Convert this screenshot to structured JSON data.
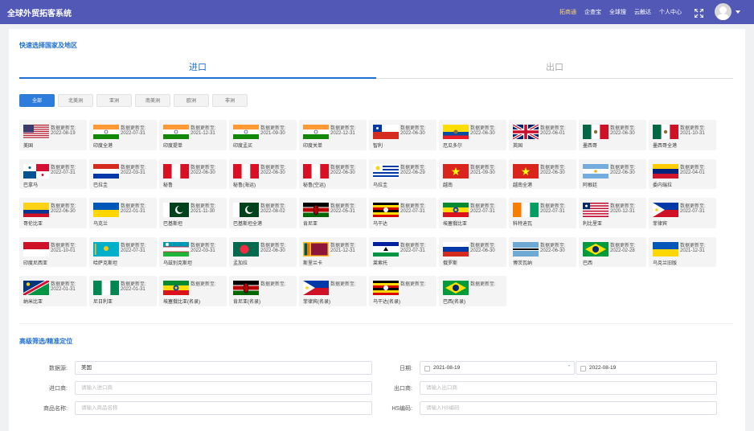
{
  "header": {
    "app_title": "全球外贸拓客系统",
    "nav": [
      {
        "label": "拓商通",
        "active": true
      },
      {
        "label": "企查宝",
        "active": false
      },
      {
        "label": "全球搜",
        "active": false
      },
      {
        "label": "云触达",
        "active": false
      },
      {
        "label": "个人中心",
        "active": false
      }
    ]
  },
  "quick_select": {
    "title": "快速选择国家及地区",
    "tabs": {
      "import": "进口",
      "export": "出口"
    },
    "regions": [
      "全部",
      "北美洲",
      "亚洲",
      "南美洲",
      "欧洲",
      "非洲"
    ],
    "update_label": "数据更新至:",
    "countries": [
      {
        "name": "美国",
        "date": "2022-08-19",
        "flag": "us"
      },
      {
        "name": "印度全港",
        "date": "2022-07-31",
        "flag": "in"
      },
      {
        "name": "印度提单",
        "date": "2021-12-31",
        "flag": "in"
      },
      {
        "name": "印度孟买",
        "date": "2021-09-30",
        "flag": "in"
      },
      {
        "name": "印度关单",
        "date": "2022-12-31",
        "flag": "in"
      },
      {
        "name": "智利",
        "date": "2022-06-30",
        "flag": "cl"
      },
      {
        "name": "厄瓜多尔",
        "date": "2022-06-30",
        "flag": "ec"
      },
      {
        "name": "英国",
        "date": "2022-06-01",
        "flag": "gb"
      },
      {
        "name": "墨西哥",
        "date": "2022-06-30",
        "flag": "mx"
      },
      {
        "name": "墨西哥全港",
        "date": "2021-10-31",
        "flag": "mx"
      },
      {
        "name": "巴拿马",
        "date": "2022-07-31",
        "flag": "pa"
      },
      {
        "name": "巴拉圭",
        "date": "2022-03-31",
        "flag": "py"
      },
      {
        "name": "秘鲁",
        "date": "2022-06-30",
        "flag": "pe"
      },
      {
        "name": "秘鲁(海运)",
        "date": "2022-06-30",
        "flag": "pe"
      },
      {
        "name": "秘鲁(空运)",
        "date": "2022-06-30",
        "flag": "pe"
      },
      {
        "name": "乌拉圭",
        "date": "2022-06-29",
        "flag": "uy"
      },
      {
        "name": "越南",
        "date": "2021-09-30",
        "flag": "vn"
      },
      {
        "name": "越南全港",
        "date": "2022-06-30",
        "flag": "vn"
      },
      {
        "name": "阿根廷",
        "date": "2022-06-30",
        "flag": "ar"
      },
      {
        "name": "委内瑞拉",
        "date": "2022-04-01",
        "flag": "ve"
      },
      {
        "name": "哥伦比亚",
        "date": "2022-06-30",
        "flag": "co"
      },
      {
        "name": "乌克兰",
        "date": "2022-01-31",
        "flag": "ua"
      },
      {
        "name": "巴基斯坦",
        "date": "2021-11-30",
        "flag": "pk"
      },
      {
        "name": "巴基斯坦全港",
        "date": "2022-08-02",
        "flag": "pk"
      },
      {
        "name": "肯尼亚",
        "date": "2022-05-31",
        "flag": "ke"
      },
      {
        "name": "乌干达",
        "date": "2022-07-31",
        "flag": "ug"
      },
      {
        "name": "埃塞俄比亚",
        "date": "2022-07-31",
        "flag": "et"
      },
      {
        "name": "科特迪瓦",
        "date": "2022-07-31",
        "flag": "ci"
      },
      {
        "name": "利比里亚",
        "date": "2020-12-31",
        "flag": "lr"
      },
      {
        "name": "菲律宾",
        "date": "2022-07-31",
        "flag": "ph"
      },
      {
        "name": "印度尼西亚",
        "date": "2021-10-01",
        "flag": "id"
      },
      {
        "name": "哈萨克斯坦",
        "date": "2022-07-31",
        "flag": "kz"
      },
      {
        "name": "乌兹别克斯坦",
        "date": "2022-03-31",
        "flag": "uz"
      },
      {
        "name": "孟加拉",
        "date": "2022-06-30",
        "flag": "bd"
      },
      {
        "name": "斯里兰卡",
        "date": "2021-12-31",
        "flag": "lk"
      },
      {
        "name": "莱索托",
        "date": "2022-07-31",
        "flag": "ls"
      },
      {
        "name": "俄罗斯",
        "date": "2022-06-30",
        "flag": "ru"
      },
      {
        "name": "博茨瓦纳",
        "date": "2022-06-30",
        "flag": "bw"
      },
      {
        "name": "巴西",
        "date": "2022-02-28",
        "flag": "br"
      },
      {
        "name": "乌克兰旧版",
        "date": "2021-12-31",
        "flag": "ua"
      },
      {
        "name": "纳米比亚",
        "date": "2022-01-31",
        "flag": "na"
      },
      {
        "name": "尼日利亚",
        "date": "2022-01-31",
        "flag": "ng"
      },
      {
        "name": "埃塞俄比亚(名录)",
        "date": "",
        "flag": "et"
      },
      {
        "name": "肯尼亚(名录)",
        "date": "",
        "flag": "ke"
      },
      {
        "name": "菲律宾(名录)",
        "date": "",
        "flag": "ph"
      },
      {
        "name": "乌干达(名录)",
        "date": "",
        "flag": "ug"
      },
      {
        "name": "巴西(名录)",
        "date": "",
        "flag": "br"
      }
    ]
  },
  "advanced": {
    "title": "高级筛选/精准定位",
    "source_label": "数据源:",
    "source_value": "美国",
    "date_label": "日期:",
    "date_start": "2021-08-19",
    "date_end": "2022-08-19",
    "date_separator": "-",
    "importer_label": "进口商:",
    "importer_placeholder": "请输入进口商",
    "exporter_label": "出口商:",
    "exporter_placeholder": "请输入出口商",
    "product_label": "商品名称:",
    "product_placeholder": "请输入商品名称",
    "hs_label": "HS编码:",
    "hs_placeholder": "请输入HS编码"
  },
  "colors": {
    "header_bg": "#5158b5",
    "accent": "#1f6fd4",
    "nav_active": "#ffd666"
  }
}
